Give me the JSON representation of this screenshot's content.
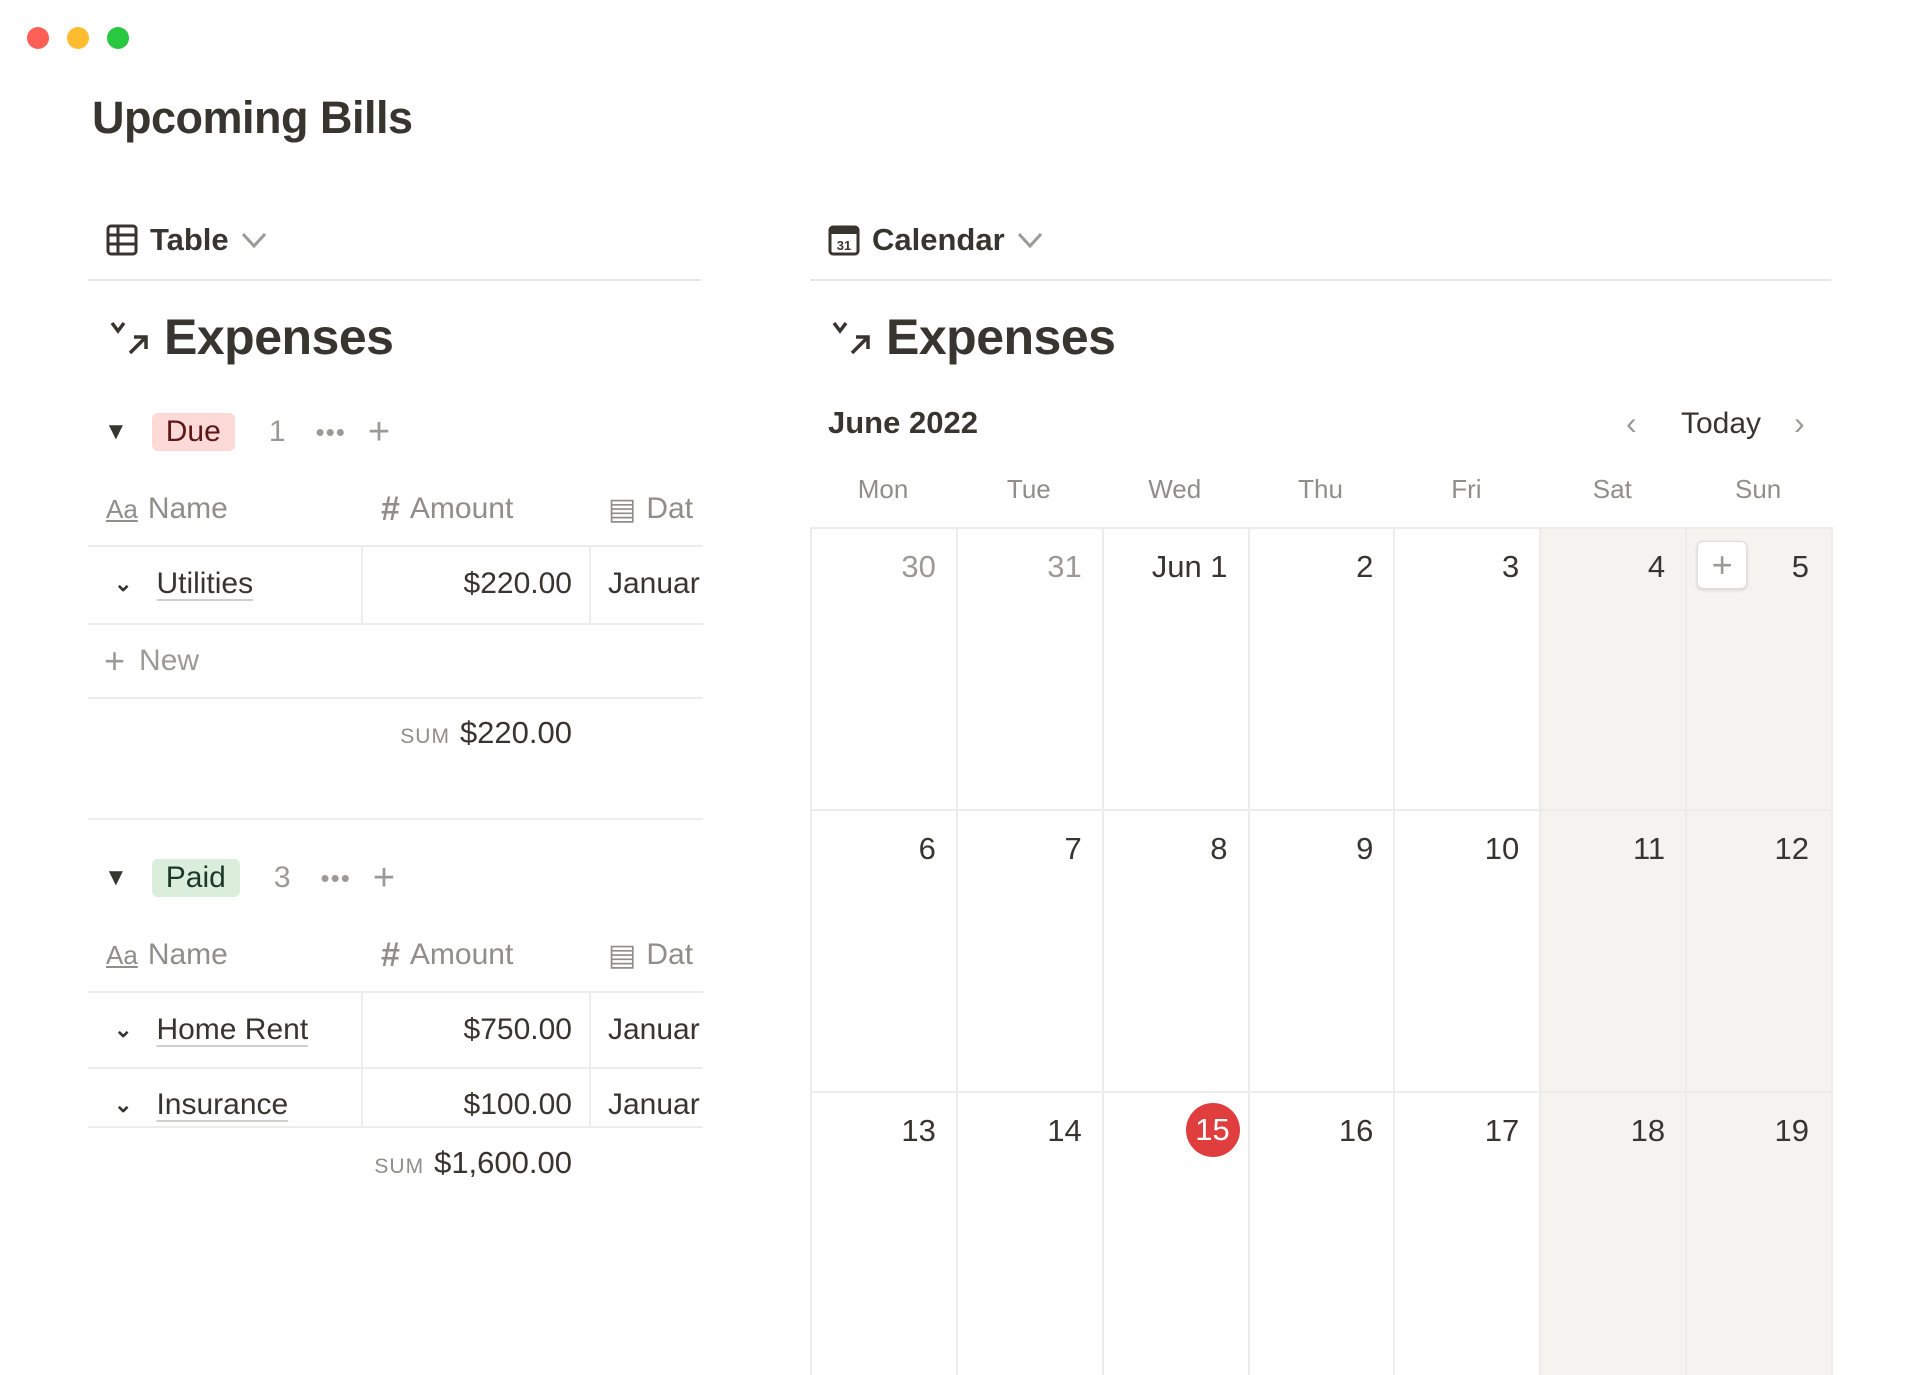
{
  "window": {
    "controls": [
      {
        "name": "close",
        "color": "#ff5f57"
      },
      {
        "name": "minimize",
        "color": "#febc2e"
      },
      {
        "name": "zoom",
        "color": "#28c840"
      }
    ]
  },
  "page": {
    "title": "Upcoming Bills"
  },
  "table_view": {
    "tab_label": "Table",
    "heading": "Expenses",
    "columns": {
      "name": "Name",
      "amount": "Amount",
      "date": "Dat"
    },
    "groups": [
      {
        "label": "Due",
        "count": "1",
        "tag_bg": "#fdd9d7",
        "tag_color": "#5d1715",
        "rows": [
          {
            "name": "Utilities",
            "amount": "$220.00",
            "date": "Januar"
          }
        ],
        "new_label": "New",
        "sum_label": "SUM",
        "sum": "$220.00"
      },
      {
        "label": "Paid",
        "count": "3",
        "tag_bg": "#dbeddb",
        "tag_color": "#1c3829",
        "rows": [
          {
            "name": "Home Rent",
            "amount": "$750.00",
            "date": "Januar"
          },
          {
            "name": "Insurance",
            "amount": "$100.00",
            "date": "Januar"
          }
        ],
        "sum_label": "SUM",
        "sum": "$1,600.00"
      }
    ]
  },
  "calendar_view": {
    "tab_label": "Calendar",
    "heading": "Expenses",
    "month": "June 2022",
    "today_label": "Today",
    "weekdays": [
      "Mon",
      "Tue",
      "Wed",
      "Thu",
      "Fri",
      "Sat",
      "Sun"
    ],
    "weeks": [
      [
        {
          "d": "30",
          "muted": true
        },
        {
          "d": "31",
          "muted": true
        },
        {
          "d": "Jun 1"
        },
        {
          "d": "2"
        },
        {
          "d": "3"
        },
        {
          "d": "4"
        },
        {
          "d": "5",
          "add_button": true
        }
      ],
      [
        {
          "d": "6"
        },
        {
          "d": "7"
        },
        {
          "d": "8"
        },
        {
          "d": "9"
        },
        {
          "d": "10"
        },
        {
          "d": "11"
        },
        {
          "d": "12"
        }
      ],
      [
        {
          "d": "13"
        },
        {
          "d": "14"
        },
        {
          "d": "15",
          "today": true
        },
        {
          "d": "16"
        },
        {
          "d": "17"
        },
        {
          "d": "18"
        },
        {
          "d": "19"
        }
      ]
    ],
    "today_color": "#e03e3e",
    "weekend_bg": "#f4f3ef"
  }
}
